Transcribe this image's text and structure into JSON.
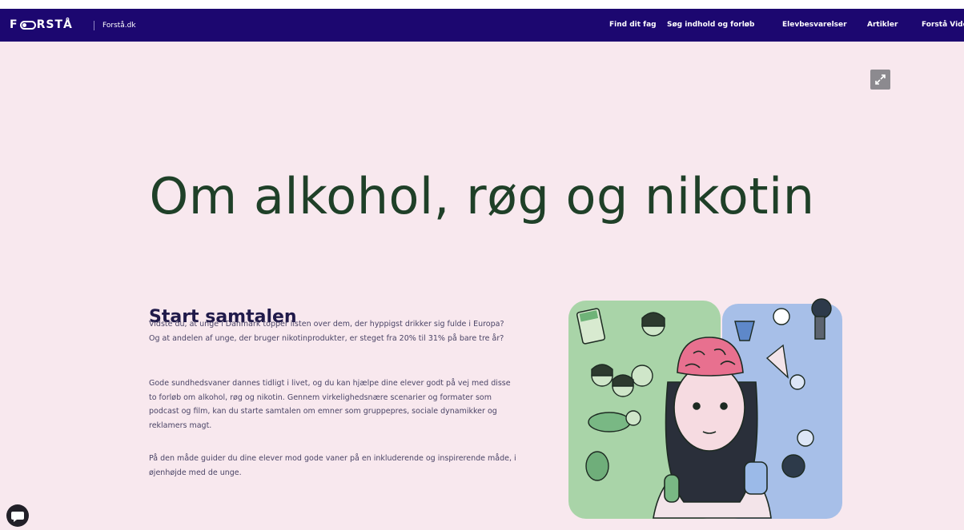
{
  "header": {
    "logo_text_left": "F",
    "logo_text_right": "RSTÅ",
    "subtitle": "Forstå.dk",
    "nav": [
      {
        "label": "Find dit fag"
      },
      {
        "label": "Søg indhold og forløb"
      },
      {
        "label": "Elevbesvarelser"
      },
      {
        "label": "Artikler"
      },
      {
        "label": "Forstå Video"
      }
    ]
  },
  "page": {
    "title": "Om alkohol, røg og nikotin"
  },
  "intro": {
    "heading": "Start samtalen",
    "paragraphs": [
      "Vidste du, at unge i Danmark topper listen over dem, der hyppigst drikker sig fulde i Europa? Og at andelen af unge, der bruger nikotinprodukter, er steget fra 20% til 31% på bare tre år?",
      "Gode sundhedsvaner dannes tidligt i livet, og du kan hjælpe dine elever godt på vej med disse to forløb om alkohol, røg og nikotin. Gennem virkelighedsnære scenarier og formater som podcast og film, kan du starte samtalen om emner som gruppepres, sociale dynamikker og reklamers magt.",
      "På den måde guider du dine elever mod gode vaner på en inkluderende og inspirerende måde, i øjenhøjde med de unge."
    ]
  },
  "icons": {
    "expand": "expand-icon",
    "chat": "chat-icon"
  },
  "colors": {
    "nav_bg": "#1c0770",
    "page_bg": "#f8e8ee",
    "title": "#1f4028",
    "heading": "#201a4a",
    "illus_green": "#a9d4a8",
    "illus_blue": "#a7bfe8"
  }
}
